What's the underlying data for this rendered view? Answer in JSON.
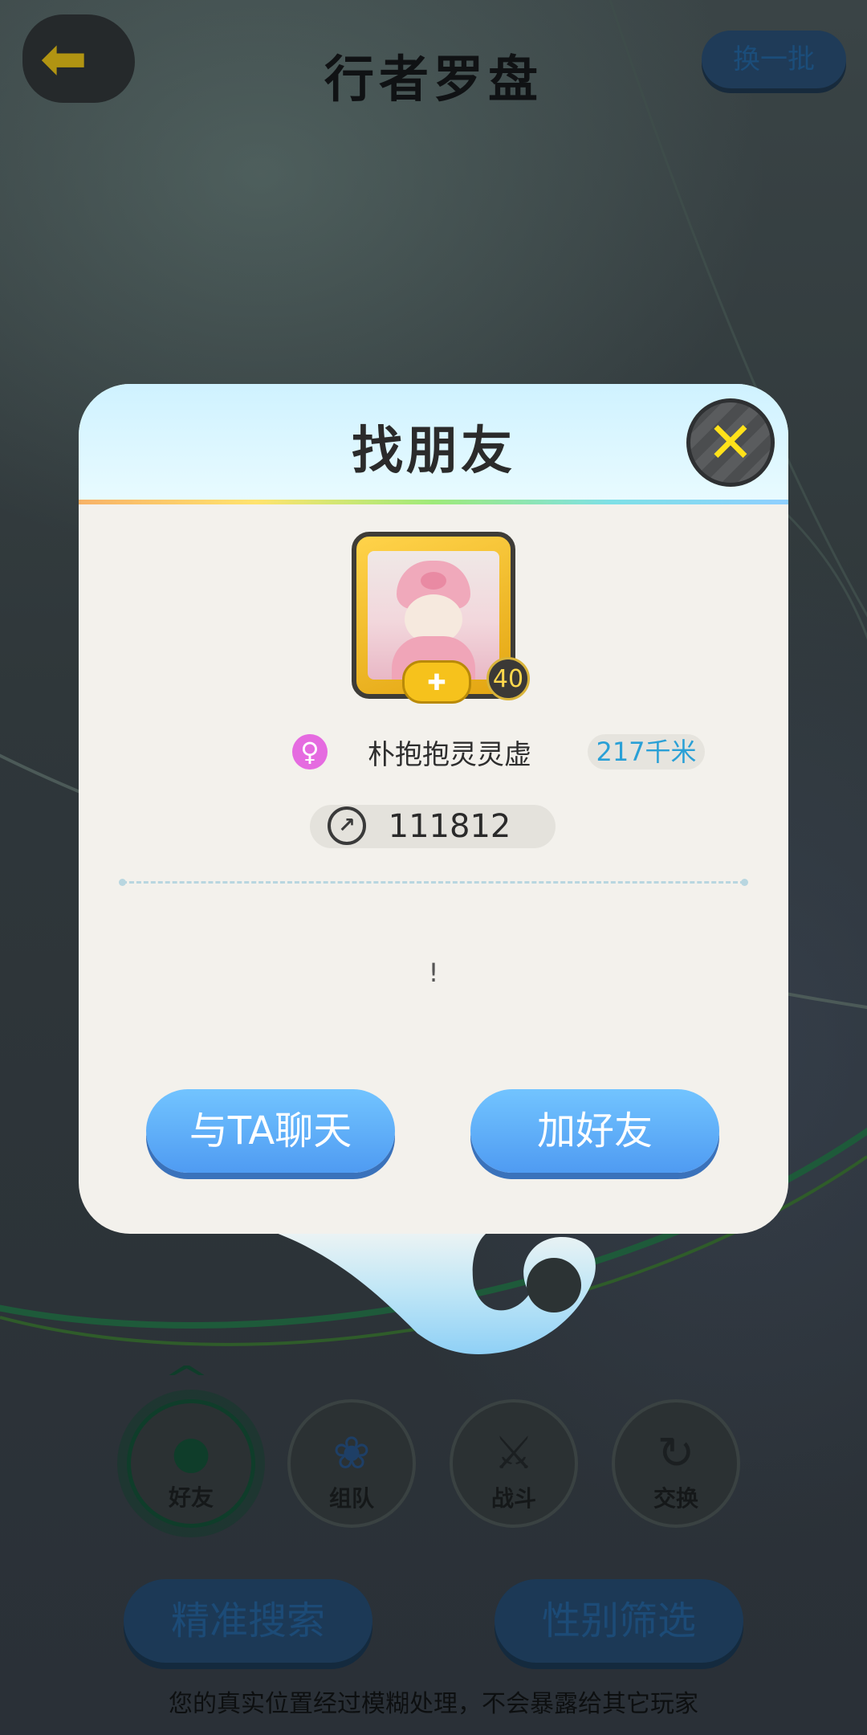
{
  "header": {
    "title": "行者罗盘",
    "refresh_label": "换一批",
    "back_icon": "arrow-left-icon"
  },
  "categories": [
    {
      "label": "好友",
      "icon": "gourd-icon",
      "color": "#0f3d2a"
    },
    {
      "label": "组队",
      "icon": "team-icon",
      "color": "#1e3f66"
    },
    {
      "label": "战斗",
      "icon": "crossed-swords-icon",
      "color": "#1b1f21"
    },
    {
      "label": "交换",
      "icon": "swap-icon",
      "color": "#1b1f21"
    }
  ],
  "bottom": {
    "search_label": "精准搜索",
    "gender_filter_label": "性别筛选",
    "note": "您的真实位置经过模糊处理，不会暴露给其它玩家"
  },
  "dialog": {
    "title": "找朋友",
    "close_icon": "close-icon",
    "player": {
      "level": "40",
      "gender_icon": "female-icon",
      "name": "朴抱抱灵灵虚",
      "distance": "217千米",
      "power": "111812"
    },
    "message": "!",
    "chat_label": "与TA聊天",
    "add_friend_label": "加好友"
  },
  "colors": {
    "accent_blue": "#4f9bf2",
    "gold": "#ffd34a",
    "close_x": "#ffe21a",
    "distance_text": "#2aa0d6"
  }
}
